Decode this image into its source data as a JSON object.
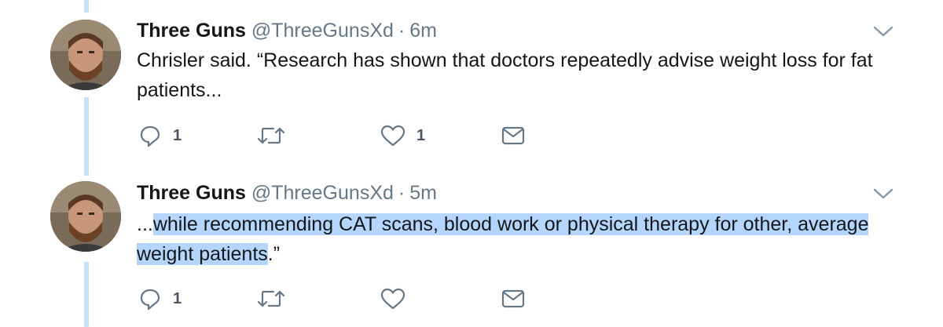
{
  "tweets": [
    {
      "name": "Three Guns",
      "handle": "@ThreeGunsXd",
      "separator": "·",
      "time": "6m",
      "text": "Chrisler said. “Research has shown that doctors repeatedly advise weight loss for fat patients...",
      "text_plain_prefix": "",
      "text_highlight": "",
      "text_suffix": "",
      "reply_count": "1",
      "retweet_count": "",
      "like_count": "1"
    },
    {
      "name": "Three Guns",
      "handle": "@ThreeGunsXd",
      "separator": "·",
      "time": "5m",
      "text_plain_prefix": "...",
      "text_highlight": "while recommending CAT scans, blood work or physical therapy for other, average weight patients",
      "text_suffix": ".”",
      "reply_count": "1",
      "retweet_count": "",
      "like_count": ""
    }
  ],
  "icons": {
    "reply": "reply-icon",
    "retweet": "retweet-icon",
    "like": "heart-icon",
    "dm": "envelope-icon",
    "caret": "chevron-down-icon"
  },
  "colors": {
    "thread_line": "#c4e2f7",
    "selection_highlight": "#b4d5fe",
    "icon_gray": "#657786"
  }
}
